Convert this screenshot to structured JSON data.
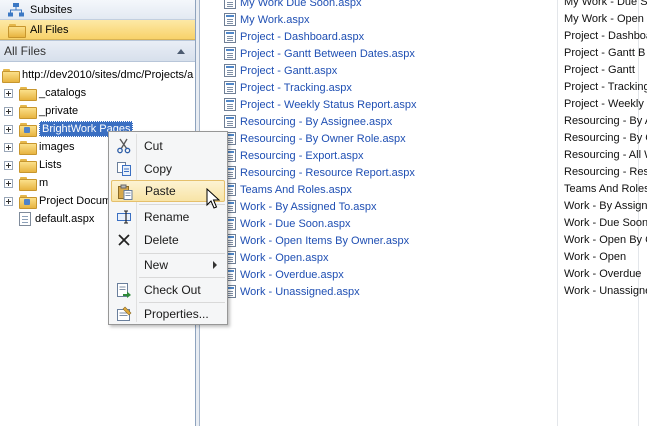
{
  "nav": {
    "subsites_label": "Subsites",
    "allfiles_label": "All Files",
    "section_header": "All Files"
  },
  "tree": {
    "root": "http://dev2010/sites/dmc/Projects/a",
    "nodes": [
      {
        "label": "_catalogs"
      },
      {
        "label": "_private"
      },
      {
        "label": "BrightWork Pages",
        "selected": true
      },
      {
        "label": "images"
      },
      {
        "label": "Lists"
      },
      {
        "label": "m"
      },
      {
        "label": "Project Docum"
      },
      {
        "label": "default.aspx"
      }
    ]
  },
  "files": {
    "rows": [
      {
        "name": "My Work Due Soon.aspx",
        "title": "My Work - Due Soon"
      },
      {
        "name": "My Work.aspx",
        "title": "My Work - Open"
      },
      {
        "name": "Project - Dashboard.aspx",
        "title": "Project - Dashboa"
      },
      {
        "name": "Project - Gantt Between Dates.aspx",
        "title": "Project - Gantt B"
      },
      {
        "name": "Project - Gantt.aspx",
        "title": "Project - Gantt"
      },
      {
        "name": "Project - Tracking.aspx",
        "title": "Project - Tracking"
      },
      {
        "name": "Project - Weekly Status Report.aspx",
        "title": "Project - Weekly"
      },
      {
        "name": "Resourcing - By Assignee.aspx",
        "title": "Resourcing - By A"
      },
      {
        "name": "Resourcing - By Owner Role.aspx",
        "title": "Resourcing - By C"
      },
      {
        "name": "Resourcing - Export.aspx",
        "title": "Resourcing - All W"
      },
      {
        "name": "Resourcing - Resource Report.aspx",
        "title": "Resourcing - Reso"
      },
      {
        "name": "Teams And Roles.aspx",
        "title": "Teams And Roles"
      },
      {
        "name": "Work - By Assigned To.aspx",
        "title": "Work - By Assigne"
      },
      {
        "name": "Work - Due Soon.aspx",
        "title": "Work - Due Soon"
      },
      {
        "name": "Work - Open Items By Owner.aspx",
        "title": "Work - Open By C"
      },
      {
        "name": "Work - Open.aspx",
        "title": "Work - Open"
      },
      {
        "name": "Work - Overdue.aspx",
        "title": "Work - Overdue"
      },
      {
        "name": "Work - Unassigned.aspx",
        "title": "Work - Unassigne"
      }
    ]
  },
  "context_menu": {
    "cut": "Cut",
    "copy": "Copy",
    "paste": "Paste",
    "rename": "Rename",
    "delete": "Delete",
    "new": "New",
    "checkout": "Check Out",
    "properties": "Properties..."
  },
  "colors": {
    "link": "#1f4fb3",
    "selection": "#3a6fc2",
    "allfiles_highlight": "#f8d26a",
    "menu_highlight": "#f8e4a6"
  }
}
